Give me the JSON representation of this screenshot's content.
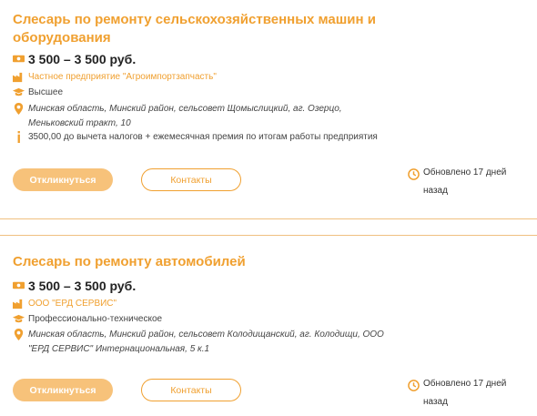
{
  "colors": {
    "accent": "#f0a030",
    "button_fill": "#f7c27a",
    "divider": "#f0c080"
  },
  "vacancies": [
    {
      "title": "Слесарь по ремонту сельскохозяйственных машин и оборудования",
      "salary": "3 500 – 3 500 руб.",
      "company": "Частное предприятие \"Агроимпортзапчасть\"",
      "education": "Высшее",
      "address": "Минская область, Минский район, сельсовет Щомыслицкий, аг. Озерцо, Меньковский тракт, 10",
      "note": "3500,00 до вычета налогов + ежемесячная премия по итогам работы предприятия",
      "apply_label": "Откликнуться",
      "contacts_label": "Контакты",
      "updated": "Обновлено 17 дней назад"
    },
    {
      "title": "Слесарь по ремонту автомобилей",
      "salary": "3 500 – 3 500 руб.",
      "company": "ООО \"ЕРД СЕРВИС\"",
      "education": "Профессионально-техническое",
      "address": "Минская область, Минский район, сельсовет Колодищанский, аг. Колодищи, ООО \"ЕРД СЕРВИС\" Интернациональная, 5 к.1",
      "apply_label": "Откликнуться",
      "contacts_label": "Контакты",
      "updated": "Обновлено 17 дней назад"
    }
  ],
  "icons": [
    "money-icon",
    "factory-icon",
    "graduation-cap-icon",
    "location-pin-icon",
    "info-icon",
    "clock-icon"
  ]
}
